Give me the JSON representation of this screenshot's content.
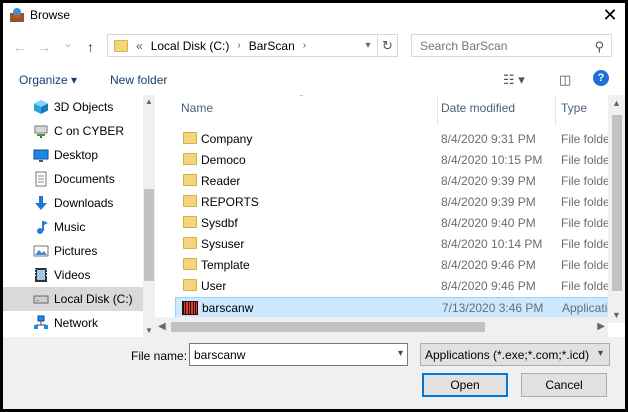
{
  "window": {
    "title": "Browse",
    "close_glyph": "✕"
  },
  "nav": {
    "back_glyph": "←",
    "forward_glyph": "→",
    "recent_glyph": "⌄",
    "up_glyph": "↑"
  },
  "address": {
    "overflow": "«",
    "crumbs": [
      "Local Disk (C:)",
      "BarScan"
    ],
    "sep_glyph": "›",
    "refresh_glyph": "↻"
  },
  "search": {
    "placeholder": "Search BarScan",
    "icon": "search-icon"
  },
  "toolbar": {
    "organize": "Organize ▾",
    "new_folder": "New folder",
    "help": "?"
  },
  "sidebar": {
    "items": [
      {
        "label": "3D Objects",
        "icon": "cube-icon"
      },
      {
        "label": "C on CYBER",
        "icon": "network-drive-icon"
      },
      {
        "label": "Desktop",
        "icon": "desktop-icon"
      },
      {
        "label": "Documents",
        "icon": "documents-icon"
      },
      {
        "label": "Downloads",
        "icon": "download-icon"
      },
      {
        "label": "Music",
        "icon": "music-icon"
      },
      {
        "label": "Pictures",
        "icon": "pictures-icon"
      },
      {
        "label": "Videos",
        "icon": "videos-icon"
      },
      {
        "label": "Local Disk (C:)",
        "icon": "disk-icon",
        "selected": true
      },
      {
        "label": "Network",
        "icon": "network-icon"
      }
    ]
  },
  "columns": {
    "name": "Name",
    "date": "Date modified",
    "type": "Type"
  },
  "files": [
    {
      "name": "Company",
      "date": "8/4/2020 9:31 PM",
      "type": "File folder",
      "kind": "folder"
    },
    {
      "name": "Democo",
      "date": "8/4/2020 10:15 PM",
      "type": "File folder",
      "kind": "folder"
    },
    {
      "name": "Reader",
      "date": "8/4/2020 9:39 PM",
      "type": "File folder",
      "kind": "folder"
    },
    {
      "name": "REPORTS",
      "date": "8/4/2020 9:39 PM",
      "type": "File folder",
      "kind": "folder"
    },
    {
      "name": "Sysdbf",
      "date": "8/4/2020 9:40 PM",
      "type": "File folder",
      "kind": "folder"
    },
    {
      "name": "Sysuser",
      "date": "8/4/2020 10:14 PM",
      "type": "File folder",
      "kind": "folder"
    },
    {
      "name": "Template",
      "date": "8/4/2020 9:46 PM",
      "type": "File folder",
      "kind": "folder"
    },
    {
      "name": "User",
      "date": "8/4/2020 9:46 PM",
      "type": "File folder",
      "kind": "folder"
    },
    {
      "name": "barscanw",
      "date": "7/13/2020 3:46 PM",
      "type": "Application",
      "kind": "app",
      "selected": true
    }
  ],
  "bottom": {
    "file_name_label": "File name:",
    "file_name_value": "barscanw",
    "file_type": "Applications (*.exe;*.com;*.icd)",
    "open": "Open",
    "cancel": "Cancel"
  },
  "colors": {
    "accent": "#0078d7",
    "selection": "#cce8ff",
    "folder": "#f3d57c"
  }
}
